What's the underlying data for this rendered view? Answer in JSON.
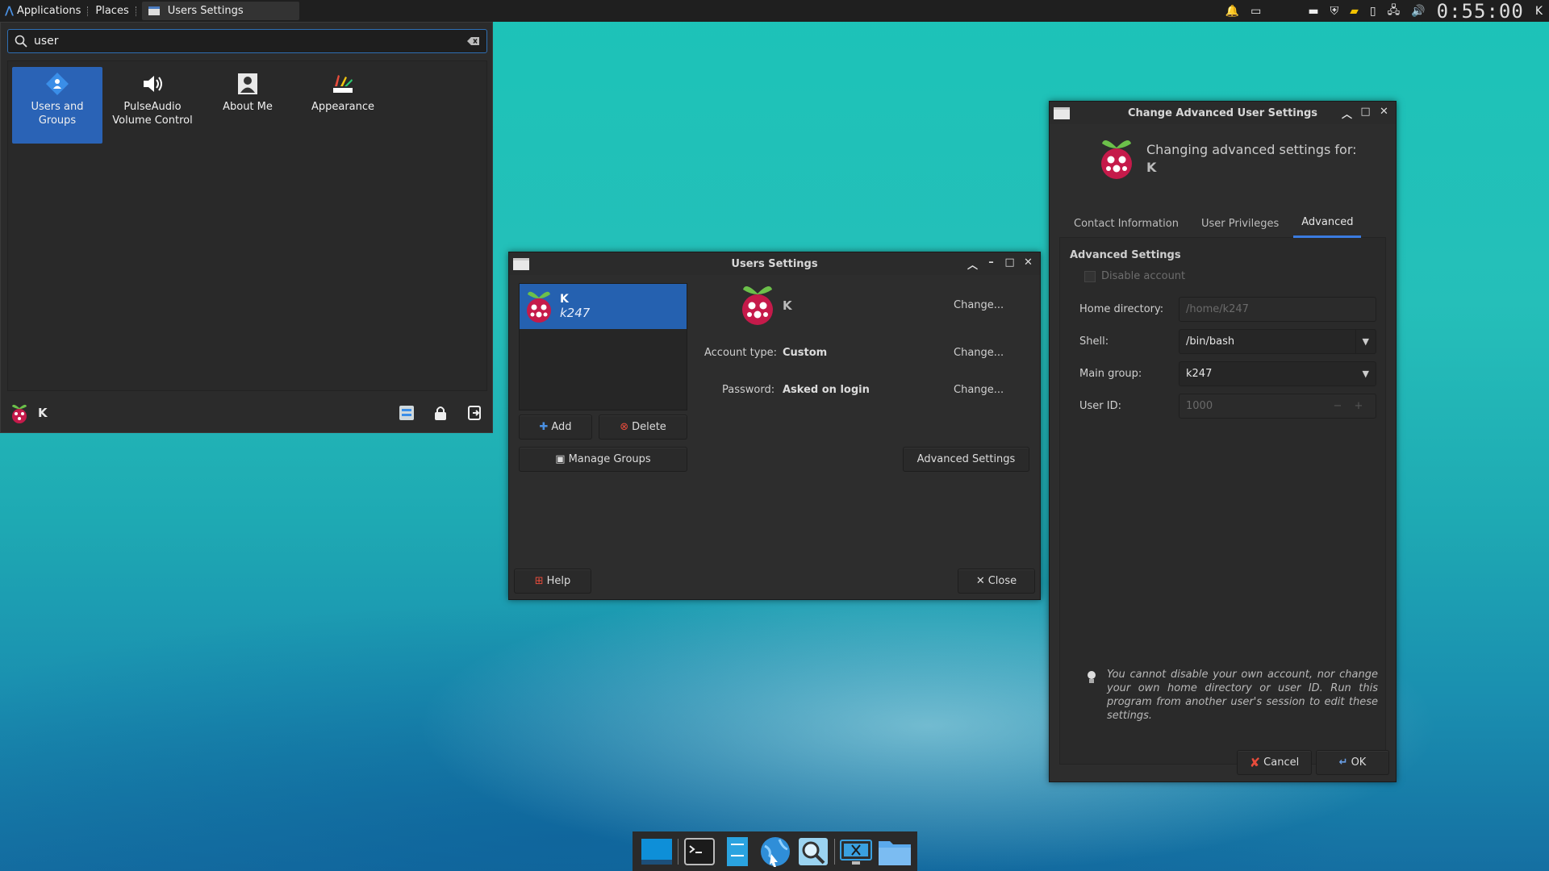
{
  "panel": {
    "applications_label": "Applications",
    "places_label": "Places",
    "task_label": "Users Settings",
    "clock": "0:55:00",
    "extra_label": "K"
  },
  "whisker": {
    "search_value": "user",
    "results": [
      {
        "label": "Users and Groups",
        "icon": "users-groups-icon",
        "selected": true
      },
      {
        "label": "PulseAudio Volume Control",
        "icon": "speaker-icon",
        "selected": false
      },
      {
        "label": "About Me",
        "icon": "about-me-icon",
        "selected": false
      },
      {
        "label": "Appearance",
        "icon": "appearance-icon",
        "selected": false
      }
    ],
    "user_name": "K"
  },
  "users_window": {
    "title": "Users Settings",
    "user": {
      "name": "K",
      "login": "k247"
    },
    "display_name": "K",
    "account_type_label": "Account type:",
    "account_type_value": "Custom",
    "password_label": "Password:",
    "password_value": "Asked on login",
    "change_label": "Change...",
    "add_label": "Add",
    "delete_label": "Delete",
    "manage_groups_label": "Manage Groups",
    "advanced_settings_label": "Advanced Settings",
    "help_label": "Help",
    "close_label": "Close"
  },
  "advanced_window": {
    "title": "Change Advanced User Settings",
    "heading_line1": "Changing advanced settings for:",
    "heading_user": "K",
    "tabs": [
      "Contact Information",
      "User Privileges",
      "Advanced"
    ],
    "active_tab": "Advanced",
    "section_title": "Advanced Settings",
    "disable_account_label": "Disable account",
    "disable_account_checked": false,
    "home_label": "Home directory:",
    "home_value": "/home/k247",
    "shell_label": "Shell:",
    "shell_value": "/bin/bash",
    "group_label": "Main group:",
    "group_value": "k247",
    "uid_label": "User ID:",
    "uid_value": "1000",
    "note": "You cannot disable your own account, nor change your own home directory or user ID. Run this program from another user's session to edit these settings.",
    "cancel_label": "Cancel",
    "ok_label": "OK"
  },
  "dock": {
    "items": [
      "desktop-icon",
      "terminal-icon",
      "file-manager-icon",
      "web-browser-icon",
      "app-finder-icon",
      "screenshot-icon",
      "folder-icon"
    ]
  },
  "colors": {
    "accent": "#2561b0",
    "tab_indicator": "#3a7be0",
    "window_bg": "#2d2d2d",
    "panel_bg": "#1f1f1f"
  }
}
